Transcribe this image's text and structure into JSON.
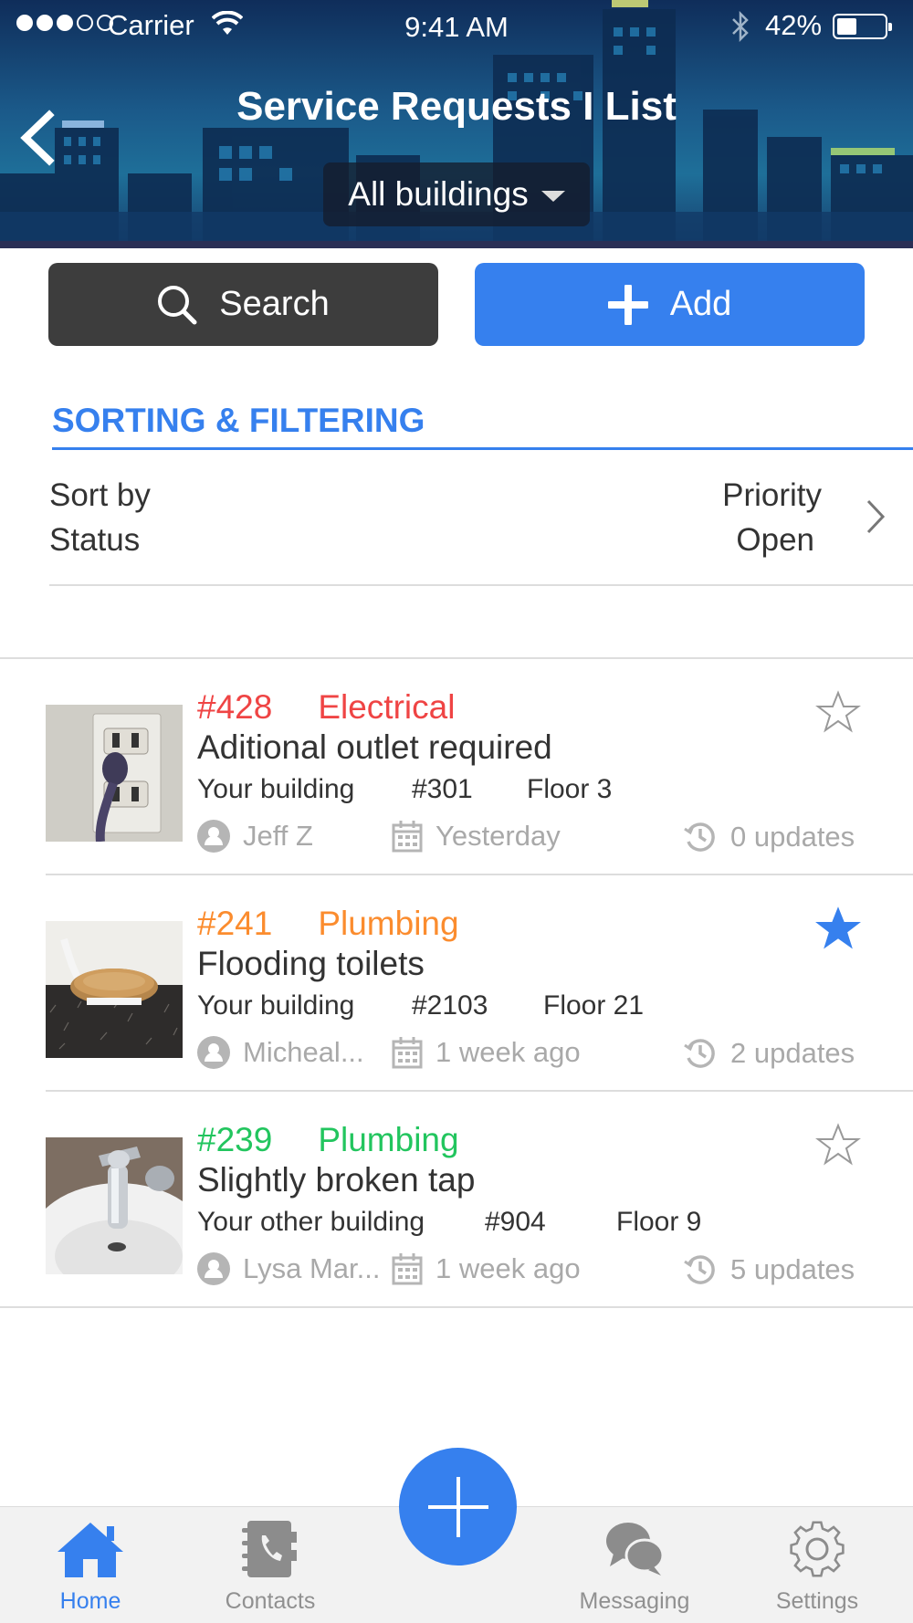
{
  "status_bar": {
    "carrier": "Carrier",
    "time": "9:41 AM",
    "battery": "42%",
    "battery_level": 0.42
  },
  "header": {
    "title": "Service Requests I List",
    "building_filter": "All buildings"
  },
  "actions": {
    "search_label": "Search",
    "add_label": "Add"
  },
  "sorting": {
    "section_title": "SORTING & FILTERING",
    "sort_label": "Sort by",
    "sort_value": "Priority",
    "status_label": "Status",
    "status_value": "Open"
  },
  "requests": [
    {
      "number": "#428",
      "category": "Electrical",
      "color": "#ef4444",
      "title": "Aditional outlet required",
      "building": "Your building",
      "unit": "#301",
      "floor": "Floor 3",
      "assignee": "Jeff Z",
      "date": "Yesterday",
      "updates": "0 updates",
      "starred": false,
      "thumbnail": "wall-outlet"
    },
    {
      "number": "#241",
      "category": "Plumbing",
      "color": "#fb8c2e",
      "title": "Flooding toilets",
      "building": "Your building",
      "unit": "#2103",
      "floor": "Floor 21",
      "assignee": "Micheal...",
      "date": "1 week ago",
      "updates": "2 updates",
      "starred": true,
      "thumbnail": "toilet-seat"
    },
    {
      "number": "#239",
      "category": "Plumbing",
      "color": "#22c55e",
      "title": "Slightly broken tap",
      "building": "Your other building",
      "unit": "#904",
      "floor": "Floor 9",
      "assignee": "Lysa Mar...",
      "date": "1 week ago",
      "updates": "5 updates",
      "starred": false,
      "thumbnail": "sink-tap"
    }
  ],
  "tabbar": {
    "home": "Home",
    "contacts": "Contacts",
    "messaging": "Messaging",
    "settings": "Settings"
  },
  "colors": {
    "accent": "#3680ee",
    "dark_button": "#3d3d3d",
    "meta_gray": "#a9a9a9"
  }
}
